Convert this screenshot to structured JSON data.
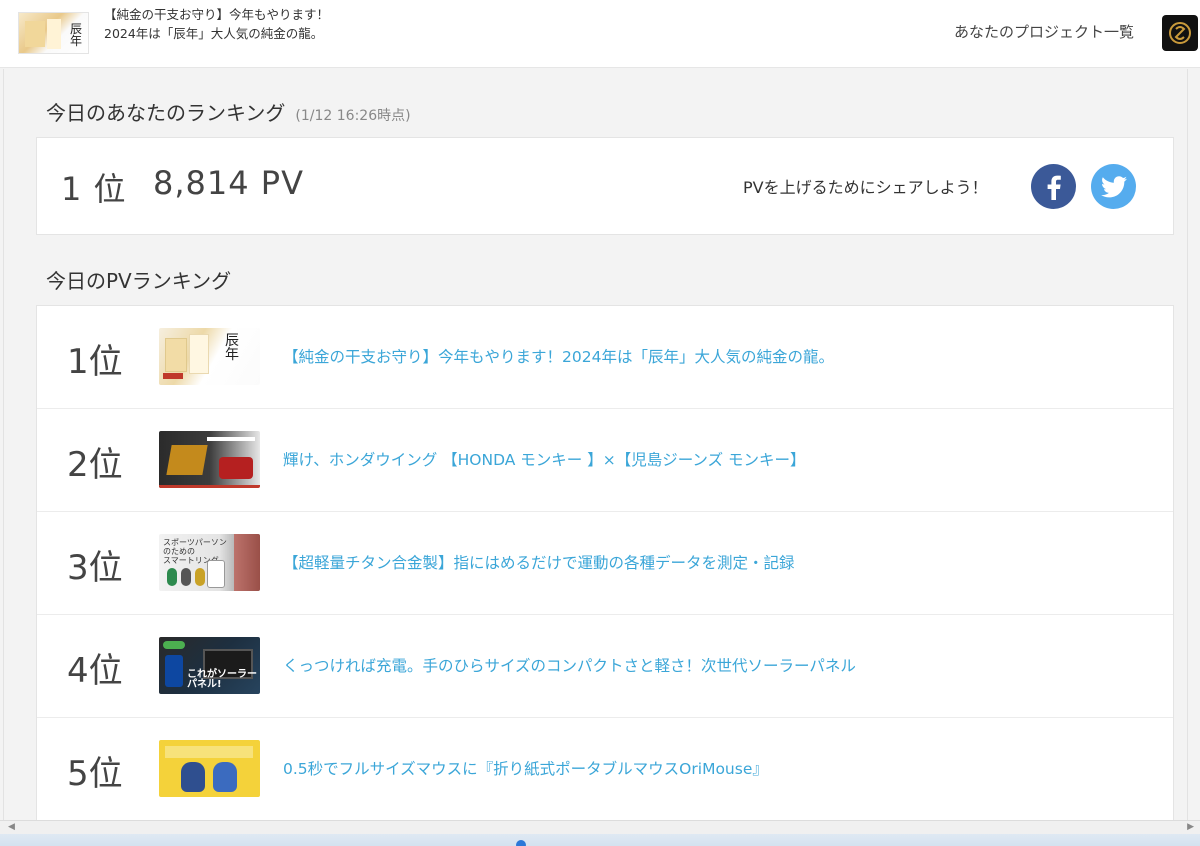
{
  "header": {
    "project_title": "【純金の干支お守り】今年もやります！2024年は「辰年」大人気の純金の龍。",
    "project_list_link": "あなたのプロジェクト一覧"
  },
  "my_ranking": {
    "heading": "今日のあなたのランキング",
    "timestamp": "(1/12 16:26時点)",
    "rank": "1 位",
    "pv": "8,814 PV",
    "share_prompt": "PVを上げるためにシェアしよう！"
  },
  "pv_ranking": {
    "heading": "今日のPVランキング",
    "items": [
      {
        "rank": "1位",
        "title": "【純金の干支お守り】今年もやります！2024年は「辰年」大人気の純金の龍。"
      },
      {
        "rank": "2位",
        "title": "輝け、ホンダウイング 【HONDA モンキー 】×【児島ジーンズ モンキー】"
      },
      {
        "rank": "3位",
        "title": "【超軽量チタン合金製】指にはめるだけで運動の各種データを測定・記録"
      },
      {
        "rank": "4位",
        "title": "くっつければ充電。手のひらサイズのコンパクトさと軽さ！次世代ソーラーパネル"
      },
      {
        "rank": "5位",
        "title": "0.5秒でフルサイズマウスに『折り紙式ポータブルマウスOriMouse』"
      }
    ]
  },
  "thumbnail_text": {
    "item1": "辰年のお守り",
    "item3": "スポーツパーソンのためのスマートリング",
    "item4": "これがソーラーパネル!"
  },
  "colors": {
    "link": "#3ba6d8",
    "facebook": "#3b5998",
    "twitter": "#55acee"
  },
  "icons": [
    "facebook-icon",
    "twitter-icon",
    "logo-icon"
  ]
}
